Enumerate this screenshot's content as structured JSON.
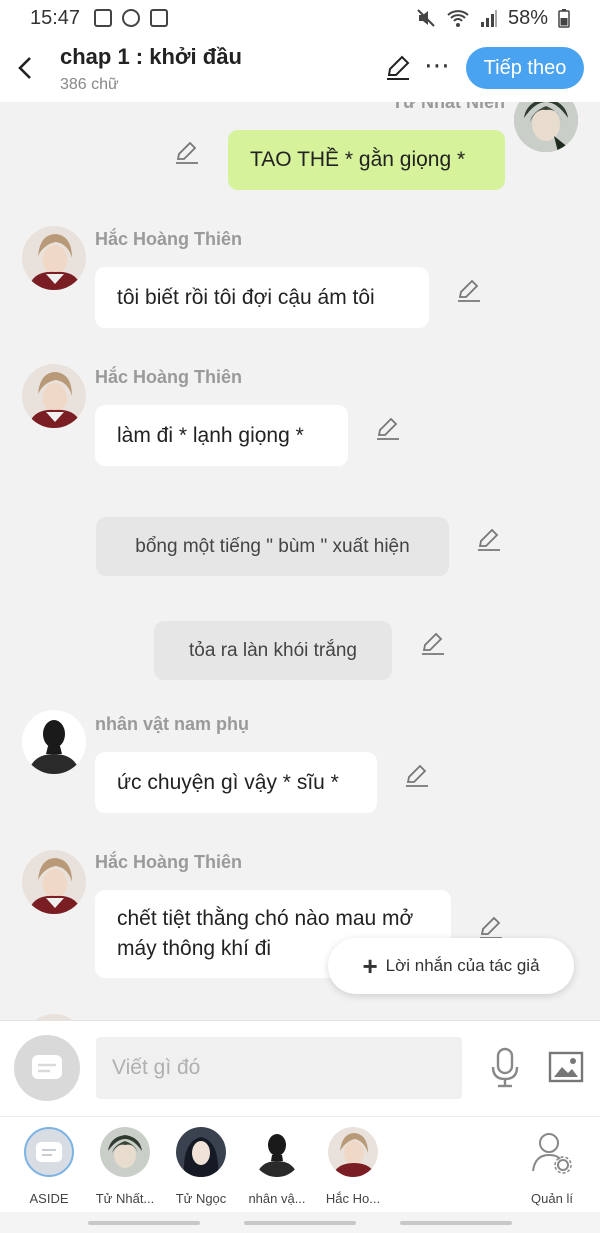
{
  "status_bar": {
    "time": "15:47",
    "battery": "58%"
  },
  "header": {
    "title": "chap 1 : khởi đầu",
    "word_count": "386 chữ",
    "next_label": "Tiếp theo"
  },
  "messages": {
    "m1": {
      "speaker": "Tử Nhất Niên",
      "text": "TAO THỀ * gằn giọng *"
    },
    "m2": {
      "speaker": "Hắc Hoàng Thiên",
      "text": "tôi biết rồi tôi đợi cậu ám tôi"
    },
    "m3": {
      "speaker": "Hắc Hoàng Thiên",
      "text": "làm đi * lạnh giọng *"
    },
    "n1": {
      "text": "bổng một tiếng \" bùm \" xuất hiện"
    },
    "n2": {
      "text": "tỏa ra làn khói trắng"
    },
    "m4": {
      "speaker": "nhân vật nam phụ",
      "text": "ức chuyện gì vậy * sĩu *"
    },
    "m5": {
      "speaker": "Hắc Hoàng Thiên",
      "text": "chết tiệt thằng chó nào mau mở máy thông khí đi"
    }
  },
  "author_note_label": "Lời nhắn của tác giả",
  "composer": {
    "placeholder": "Viết gì đó"
  },
  "characters": [
    {
      "label": "ASIDE"
    },
    {
      "label": "Tử Nhất..."
    },
    {
      "label": "Tử Ngọc"
    },
    {
      "label": "nhân vậ..."
    },
    {
      "label": "Hắc Ho..."
    },
    {
      "label": "Quản lí"
    }
  ],
  "colors": {
    "accent": "#4aa3f0",
    "protagonist_bubble": "#d6f29a",
    "narration_bubble": "#e6e6e6"
  }
}
